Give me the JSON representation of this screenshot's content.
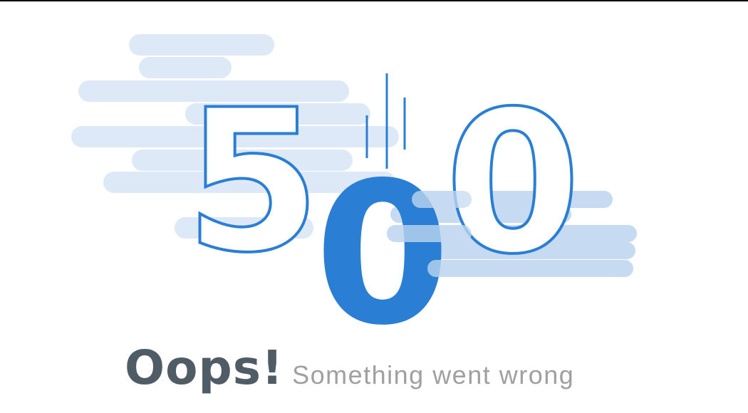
{
  "error": {
    "digit_first": "5",
    "digit_middle": "0",
    "digit_last": "0"
  },
  "message": {
    "title": "Oops!",
    "subtitle": "Something went wrong"
  },
  "colors": {
    "accent": "#2a7fd4",
    "cloud_light": "#dde9f7",
    "cloud_mid": "#c6dbf2",
    "title_text": "#4f5c65",
    "subtitle_text": "#a0a0a0"
  }
}
